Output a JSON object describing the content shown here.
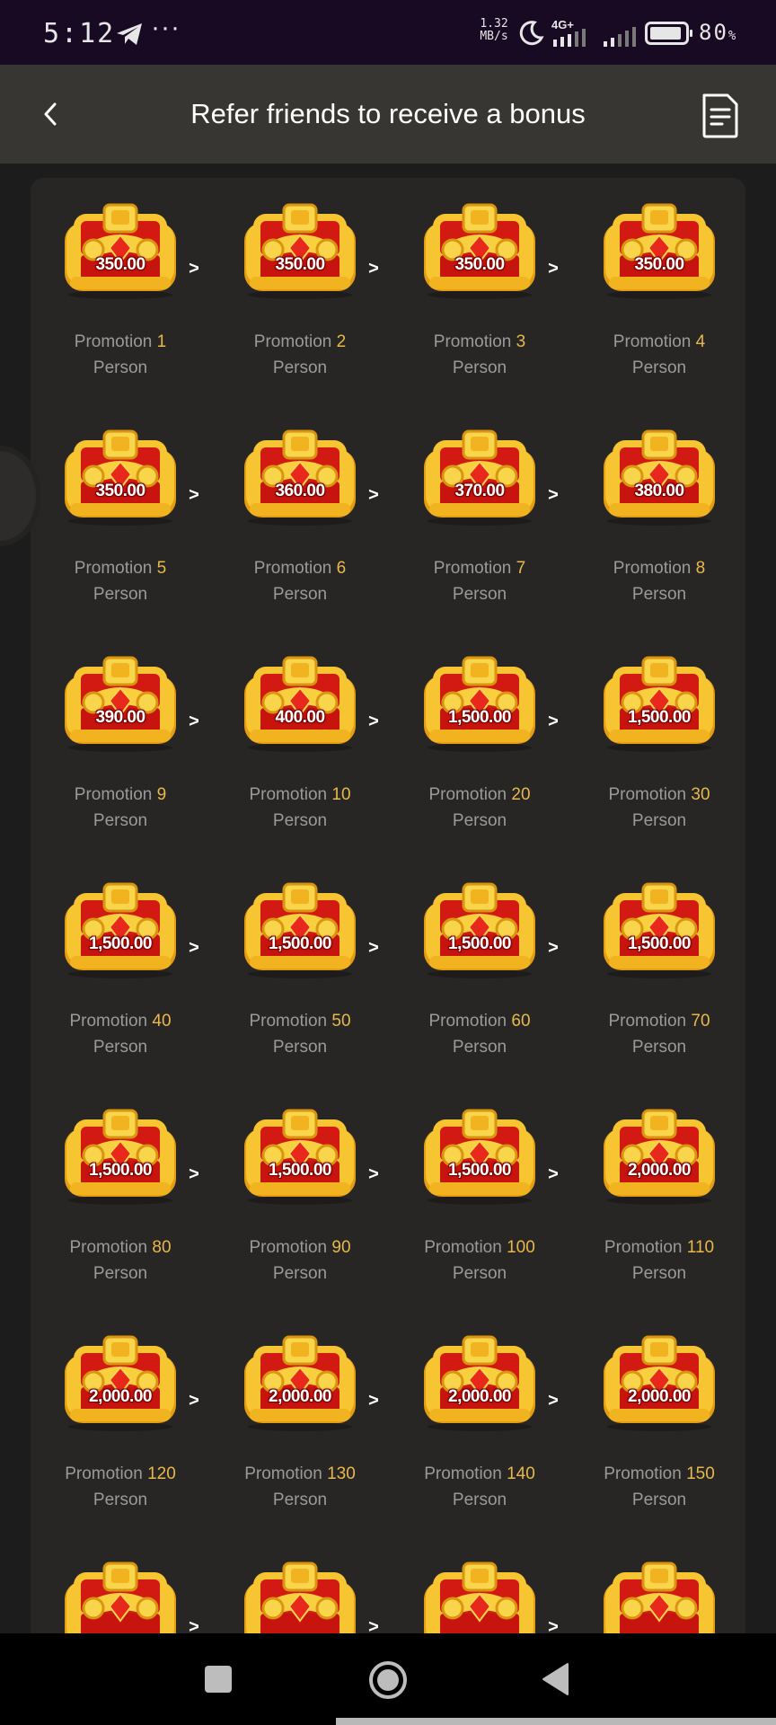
{
  "status_bar": {
    "time": "5:12",
    "more": "···",
    "net_speed_value": "1.32",
    "net_speed_unit": "MB/s",
    "network_type": "4G+",
    "battery_percent": "80",
    "battery_unit": "%",
    "icons": [
      "telegram-icon",
      "moon-icon",
      "signal-icon",
      "battery-icon"
    ]
  },
  "header": {
    "title": "Refer friends to receive a bonus",
    "back_icon": "chevron-left-icon",
    "rules_icon": "document-icon"
  },
  "tiers": [
    {
      "amount": "350.00",
      "prefix": "Promotion",
      "count": "1",
      "unit": "Person"
    },
    {
      "amount": "350.00",
      "prefix": "Promotion",
      "count": "2",
      "unit": "Person"
    },
    {
      "amount": "350.00",
      "prefix": "Promotion",
      "count": "3",
      "unit": "Person"
    },
    {
      "amount": "350.00",
      "prefix": "Promotion",
      "count": "4",
      "unit": "Person"
    },
    {
      "amount": "350.00",
      "prefix": "Promotion",
      "count": "5",
      "unit": "Person"
    },
    {
      "amount": "360.00",
      "prefix": "Promotion",
      "count": "6",
      "unit": "Person"
    },
    {
      "amount": "370.00",
      "prefix": "Promotion",
      "count": "7",
      "unit": "Person"
    },
    {
      "amount": "380.00",
      "prefix": "Promotion",
      "count": "8",
      "unit": "Person"
    },
    {
      "amount": "390.00",
      "prefix": "Promotion",
      "count": "9",
      "unit": "Person"
    },
    {
      "amount": "400.00",
      "prefix": "Promotion",
      "count": "10",
      "unit": "Person"
    },
    {
      "amount": "1,500.00",
      "prefix": "Promotion",
      "count": "20",
      "unit": "Person"
    },
    {
      "amount": "1,500.00",
      "prefix": "Promotion",
      "count": "30",
      "unit": "Person"
    },
    {
      "amount": "1,500.00",
      "prefix": "Promotion",
      "count": "40",
      "unit": "Person"
    },
    {
      "amount": "1,500.00",
      "prefix": "Promotion",
      "count": "50",
      "unit": "Person"
    },
    {
      "amount": "1,500.00",
      "prefix": "Promotion",
      "count": "60",
      "unit": "Person"
    },
    {
      "amount": "1,500.00",
      "prefix": "Promotion",
      "count": "70",
      "unit": "Person"
    },
    {
      "amount": "1,500.00",
      "prefix": "Promotion",
      "count": "80",
      "unit": "Person"
    },
    {
      "amount": "1,500.00",
      "prefix": "Promotion",
      "count": "90",
      "unit": "Person"
    },
    {
      "amount": "1,500.00",
      "prefix": "Promotion",
      "count": "100",
      "unit": "Person"
    },
    {
      "amount": "2,000.00",
      "prefix": "Promotion",
      "count": "110",
      "unit": "Person"
    },
    {
      "amount": "2,000.00",
      "prefix": "Promotion",
      "count": "120",
      "unit": "Person"
    },
    {
      "amount": "2,000.00",
      "prefix": "Promotion",
      "count": "130",
      "unit": "Person"
    },
    {
      "amount": "2,000.00",
      "prefix": "Promotion",
      "count": "140",
      "unit": "Person"
    },
    {
      "amount": "2,000.00",
      "prefix": "Promotion",
      "count": "150",
      "unit": "Person"
    },
    {
      "amount": "",
      "prefix": "",
      "count": "",
      "unit": ""
    },
    {
      "amount": "",
      "prefix": "",
      "count": "",
      "unit": ""
    },
    {
      "amount": "",
      "prefix": "",
      "count": "",
      "unit": ""
    },
    {
      "amount": "",
      "prefix": "",
      "count": "",
      "unit": ""
    }
  ],
  "arrow_symbol": ">",
  "nav_bar": {
    "icons": [
      "recents-square-icon",
      "home-circle-icon",
      "back-triangle-icon"
    ]
  },
  "colors": {
    "status_bg": "#180a23",
    "header_bg": "#373632",
    "page_bg": "#1c1c1c",
    "panel_bg": "#272625",
    "count_accent": "#e8b84a",
    "label_gray": "#9a9a9a"
  }
}
